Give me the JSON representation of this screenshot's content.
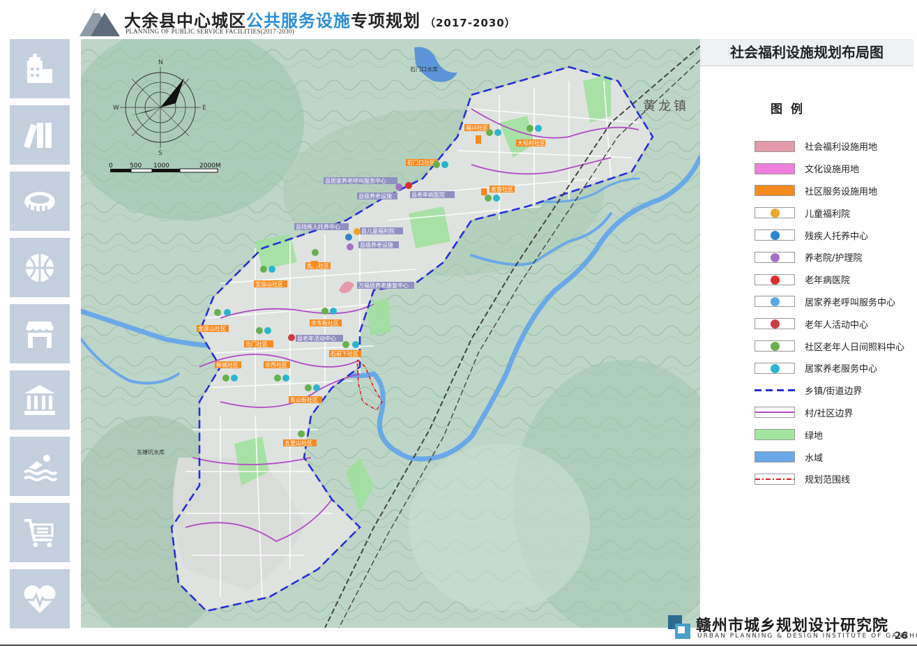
{
  "header": {
    "title_black": "大余县中心城区",
    "title_blue": "公共服务设施",
    "title_black2": "专项规划",
    "title_year": "（2017-2030）",
    "subtitle": "PLANNING OF PUBLIC SERVICE FACILITIES(2017-2030)"
  },
  "sidebar": {
    "items": [
      {
        "icon": "hospital-icon"
      },
      {
        "icon": "books-icon"
      },
      {
        "icon": "stadium-icon"
      },
      {
        "icon": "basketball-icon"
      },
      {
        "icon": "shop-icon"
      },
      {
        "icon": "museum-icon"
      },
      {
        "icon": "swimming-icon"
      },
      {
        "icon": "shopping-cart-icon"
      },
      {
        "icon": "heart-pulse-icon"
      }
    ]
  },
  "map": {
    "compass": {
      "n": "N",
      "s": "S",
      "e": "E",
      "w": "W"
    },
    "scale": {
      "t0": "0",
      "t1": "500",
      "t2": "1000",
      "t3": "2000M"
    },
    "places": {
      "huanglong": "黄龙镇",
      "shimen_reservoir": "石门口水库",
      "dongtangkeng_reservoir": "东塘坑水库"
    },
    "communities": [
      "福兴社区",
      "大坝村社区",
      "石门口社区",
      "麦畲社区",
      "南门社区",
      "宝庙山社区",
      "金莲山社区",
      "北门社区",
      "余东街社区",
      "石前下社区",
      "新城社区",
      "余西社区",
      "东山街社区",
      "五里山社区"
    ],
    "facilities": [
      "县居家养老呼叫服务中心",
      "县级养老设施",
      "县老年病医院",
      "县残疾人托养中心",
      "县儿童福利院",
      "县级养老设施",
      "万福居养老康复中心",
      "县老年活动中心"
    ]
  },
  "panel": {
    "title": "社会福利设施规划布局图",
    "legend_title": "图例",
    "legend": [
      {
        "label": "社会福利设施用地",
        "color": "#e49bab",
        "kind": "fill"
      },
      {
        "label": "文化设施用地",
        "color": "#ee7fdc",
        "kind": "fill"
      },
      {
        "label": "社区服务设施用地",
        "color": "#f58a1e",
        "kind": "fill"
      },
      {
        "label": "儿童福利院",
        "color": "#f0a523",
        "kind": "dot"
      },
      {
        "label": "残疾人托养中心",
        "color": "#2a86d2",
        "kind": "dot"
      },
      {
        "label": "养老院/护理院",
        "color": "#a471c7",
        "kind": "dot"
      },
      {
        "label": "老年病医院",
        "color": "#e12b2b",
        "kind": "dot"
      },
      {
        "label": "居家养老呼叫服务中心",
        "color": "#5aa7e6",
        "kind": "dot"
      },
      {
        "label": "老年人活动中心",
        "color": "#cf3b44",
        "kind": "dot"
      },
      {
        "label": "社区老年人日间照料中心",
        "color": "#67b04f",
        "kind": "dot"
      },
      {
        "label": "居家养老服务中心",
        "color": "#2ab5cf",
        "kind": "dot"
      },
      {
        "label": "乡镇/街道边界",
        "color": "#2430d8",
        "kind": "dash"
      },
      {
        "label": "村/社区边界",
        "color": "#b14bc6",
        "kind": "line"
      },
      {
        "label": "绿地",
        "color": "#a4e6a0",
        "kind": "fill"
      },
      {
        "label": "水域",
        "color": "#6aa8e8",
        "kind": "fill"
      },
      {
        "label": "规划范围线",
        "color": "#d62020",
        "kind": "dashdot"
      }
    ]
  },
  "footer": {
    "org_name": "赣州市城乡规划设计研究院",
    "org_en": "URBAN PLANNING & DESIGN INSTITUTE OF GANZHOU",
    "page": "26"
  }
}
